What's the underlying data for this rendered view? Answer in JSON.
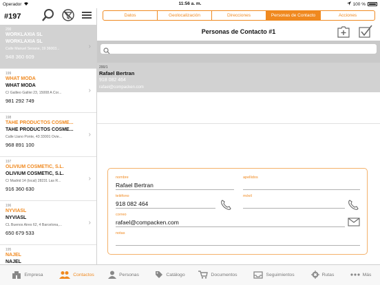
{
  "status_bar": {
    "carrier": "Operador",
    "time": "11:56 a. m.",
    "battery": "100 %"
  },
  "left_pane": {
    "count": "#197",
    "items": [
      {
        "code": "200",
        "name1": "WORKLAXIA SL",
        "name2": "WORKLAXIA SL",
        "address": "Calle Manuel Seoane, 19 36003...",
        "phone": "948 360 609",
        "selected": true
      },
      {
        "code": "199",
        "name1": "WHAT MODA",
        "name2": "WHAT MODA",
        "address": "C/ Galileo Galilei 23, 15008 A Cor...",
        "phone": "981 292 749",
        "selected": false
      },
      {
        "code": "198",
        "name1": "TAHE PRODUCTOS COSMÉ...",
        "name2": "TAHE PRODUCTOS COSMÉ...",
        "address": "Calle Llano Ponte, 43 33001 Ovie...",
        "phone": "968 891 100",
        "selected": false
      },
      {
        "code": "197",
        "name1": "OLIVIUM COSMETIC, S.L.",
        "name2": "OLIVIUM COSMETIC, S.L.",
        "address": "C/ Madrid 14 (local)  28231 Las R...",
        "phone": "916 360 630",
        "selected": false
      },
      {
        "code": "196",
        "name1": "NYVIASL",
        "name2": "NYVIASL",
        "address": "CL Buenos Aires 62, 4 Barcelona,...",
        "phone": "650 679 533",
        "selected": false
      },
      {
        "code": "195",
        "name1": "NAJEL",
        "name2": "NAJEL",
        "address": "",
        "phone": "",
        "selected": false
      }
    ]
  },
  "segments": [
    {
      "label": "Datos",
      "active": false
    },
    {
      "label": "Geolocalización",
      "active": false
    },
    {
      "label": "Direcciones",
      "active": false
    },
    {
      "label": "Personas de Contacto",
      "active": true
    },
    {
      "label": "Acciones",
      "active": false
    }
  ],
  "detail": {
    "title": "Personas de Contacto #1",
    "contact": {
      "code": "200/1",
      "name": "Rafael Bertran",
      "phone": "918 082 464",
      "email": "rafael@compacken.com"
    }
  },
  "form": {
    "nombre_label": "nombre",
    "nombre_value": "Rafael Bertran",
    "apellidos_label": "apellidos",
    "apellidos_value": "",
    "telefono_label": "teléfono",
    "telefono_value": "918 082 464",
    "movil_label": "móvil",
    "movil_value": "",
    "correo_label": "correo",
    "correo_value": "rafael@compacken.com",
    "notas_label": "notas",
    "notas_value": ""
  },
  "tabbar": [
    {
      "label": "Empresa",
      "icon": "building-icon",
      "active": false
    },
    {
      "label": "Contactos",
      "icon": "people-icon",
      "active": true
    },
    {
      "label": "Personas",
      "icon": "person-icon",
      "active": false
    },
    {
      "label": "Catálogo",
      "icon": "tag-icon",
      "active": false
    },
    {
      "label": "Documentos",
      "icon": "cart-icon",
      "active": false
    },
    {
      "label": "Seguimientos",
      "icon": "inbox-icon",
      "active": false
    },
    {
      "label": "Rutas",
      "icon": "gear-icon",
      "active": false
    },
    {
      "label": "Más",
      "icon": "more-icon",
      "active": false
    }
  ],
  "colors": {
    "accent": "#f0891f",
    "selected_row": "#d2d2d2",
    "search_bar": "#c9c9c9"
  }
}
